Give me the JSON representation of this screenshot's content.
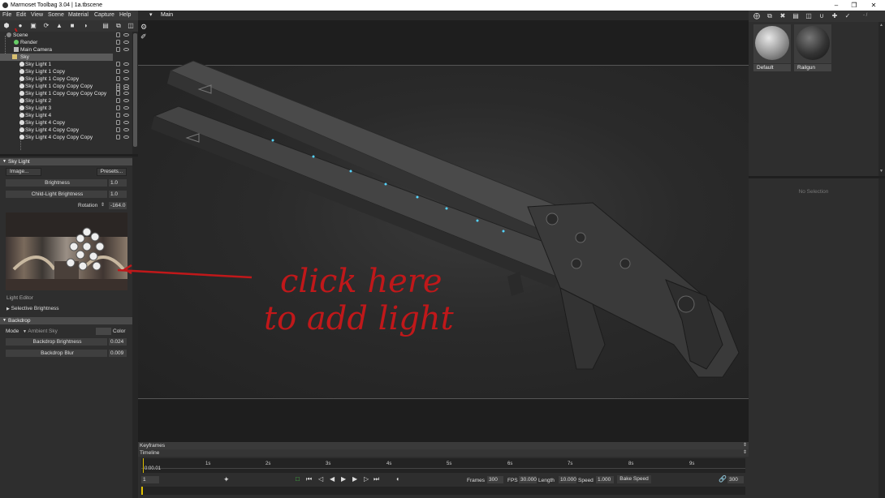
{
  "window": {
    "title": "Marmoset Toolbag 3.04  |  1a.tbscene"
  },
  "menu": [
    "File",
    "Edit",
    "View",
    "Scene",
    "Material",
    "Capture",
    "Help"
  ],
  "scene_tree": {
    "items": [
      {
        "label": "Scene",
        "icon": "scene-icon"
      },
      {
        "label": "Render",
        "icon": "render-icon"
      },
      {
        "label": "Main Camera",
        "icon": "camera-icon"
      },
      {
        "label": "Sky",
        "icon": "folder-icon"
      },
      {
        "label": "Sky Light 1",
        "icon": "light-icon"
      },
      {
        "label": "Sky Light 1 Copy",
        "icon": "light-icon"
      },
      {
        "label": "Sky Light 1 Copy Copy",
        "icon": "light-icon"
      },
      {
        "label": "Sky Light 1 Copy Copy Copy",
        "icon": "light-icon"
      },
      {
        "label": "Sky Light 1 Copy Copy Copy Copy",
        "icon": "light-icon"
      },
      {
        "label": "Sky Light 2",
        "icon": "light-icon"
      },
      {
        "label": "Sky Light 3",
        "icon": "light-icon"
      },
      {
        "label": "Sky Light 4",
        "icon": "light-icon"
      },
      {
        "label": "Sky Light 4 Copy",
        "icon": "light-icon"
      },
      {
        "label": "Sky Light 4 Copy Copy",
        "icon": "light-icon"
      },
      {
        "label": "Sky Light 4 Copy Copy Copy",
        "icon": "light-icon"
      }
    ]
  },
  "sky_light": {
    "header": "Sky Light",
    "image_button": "Image...",
    "presets_button": "Presets...",
    "brightness_label": "Brightness",
    "brightness_value": "1.0",
    "child_brightness_label": "Child-Light Brightness",
    "child_brightness_value": "1.0",
    "rotation_label": "Rotation",
    "rotation_value": "-164.0",
    "light_editor_label": "Light Editor",
    "selective_brightness": "Selective Brightness"
  },
  "backdrop": {
    "header": "Backdrop",
    "mode_label": "Mode",
    "mode_value": "Ambient Sky",
    "color_label": "Color",
    "brightness_label": "Backdrop Brightness",
    "brightness_value": "0.024",
    "blur_label": "Backdrop Blur",
    "blur_value": "0.009"
  },
  "viewport": {
    "camera_label": "Main Camera",
    "annotation_line1": "click here",
    "annotation_line2": "to add light",
    "annotation_color": "#c0181a"
  },
  "timeline": {
    "keyframes_label": "Keyframes",
    "timeline_label": "Timeline",
    "current_time": "0:00.01",
    "ticks": [
      "1s",
      "2s",
      "3s",
      "4s",
      "5s",
      "6s",
      "7s",
      "8s",
      "9s"
    ],
    "frame_value": "1",
    "frames_label": "Frames",
    "frames_value": "300",
    "fps_label": "FPS",
    "fps_value": "30.000",
    "length_label": "Length",
    "length_value": "10.000",
    "speed_label": "Speed",
    "speed_value": "1.000",
    "bake_speed": "Bake Speed",
    "end_frame": "300"
  },
  "materials": {
    "items": [
      {
        "label": "Default"
      },
      {
        "label": "Railgun"
      }
    ],
    "no_selection": "No Selection",
    "zoom_label": "- /"
  }
}
